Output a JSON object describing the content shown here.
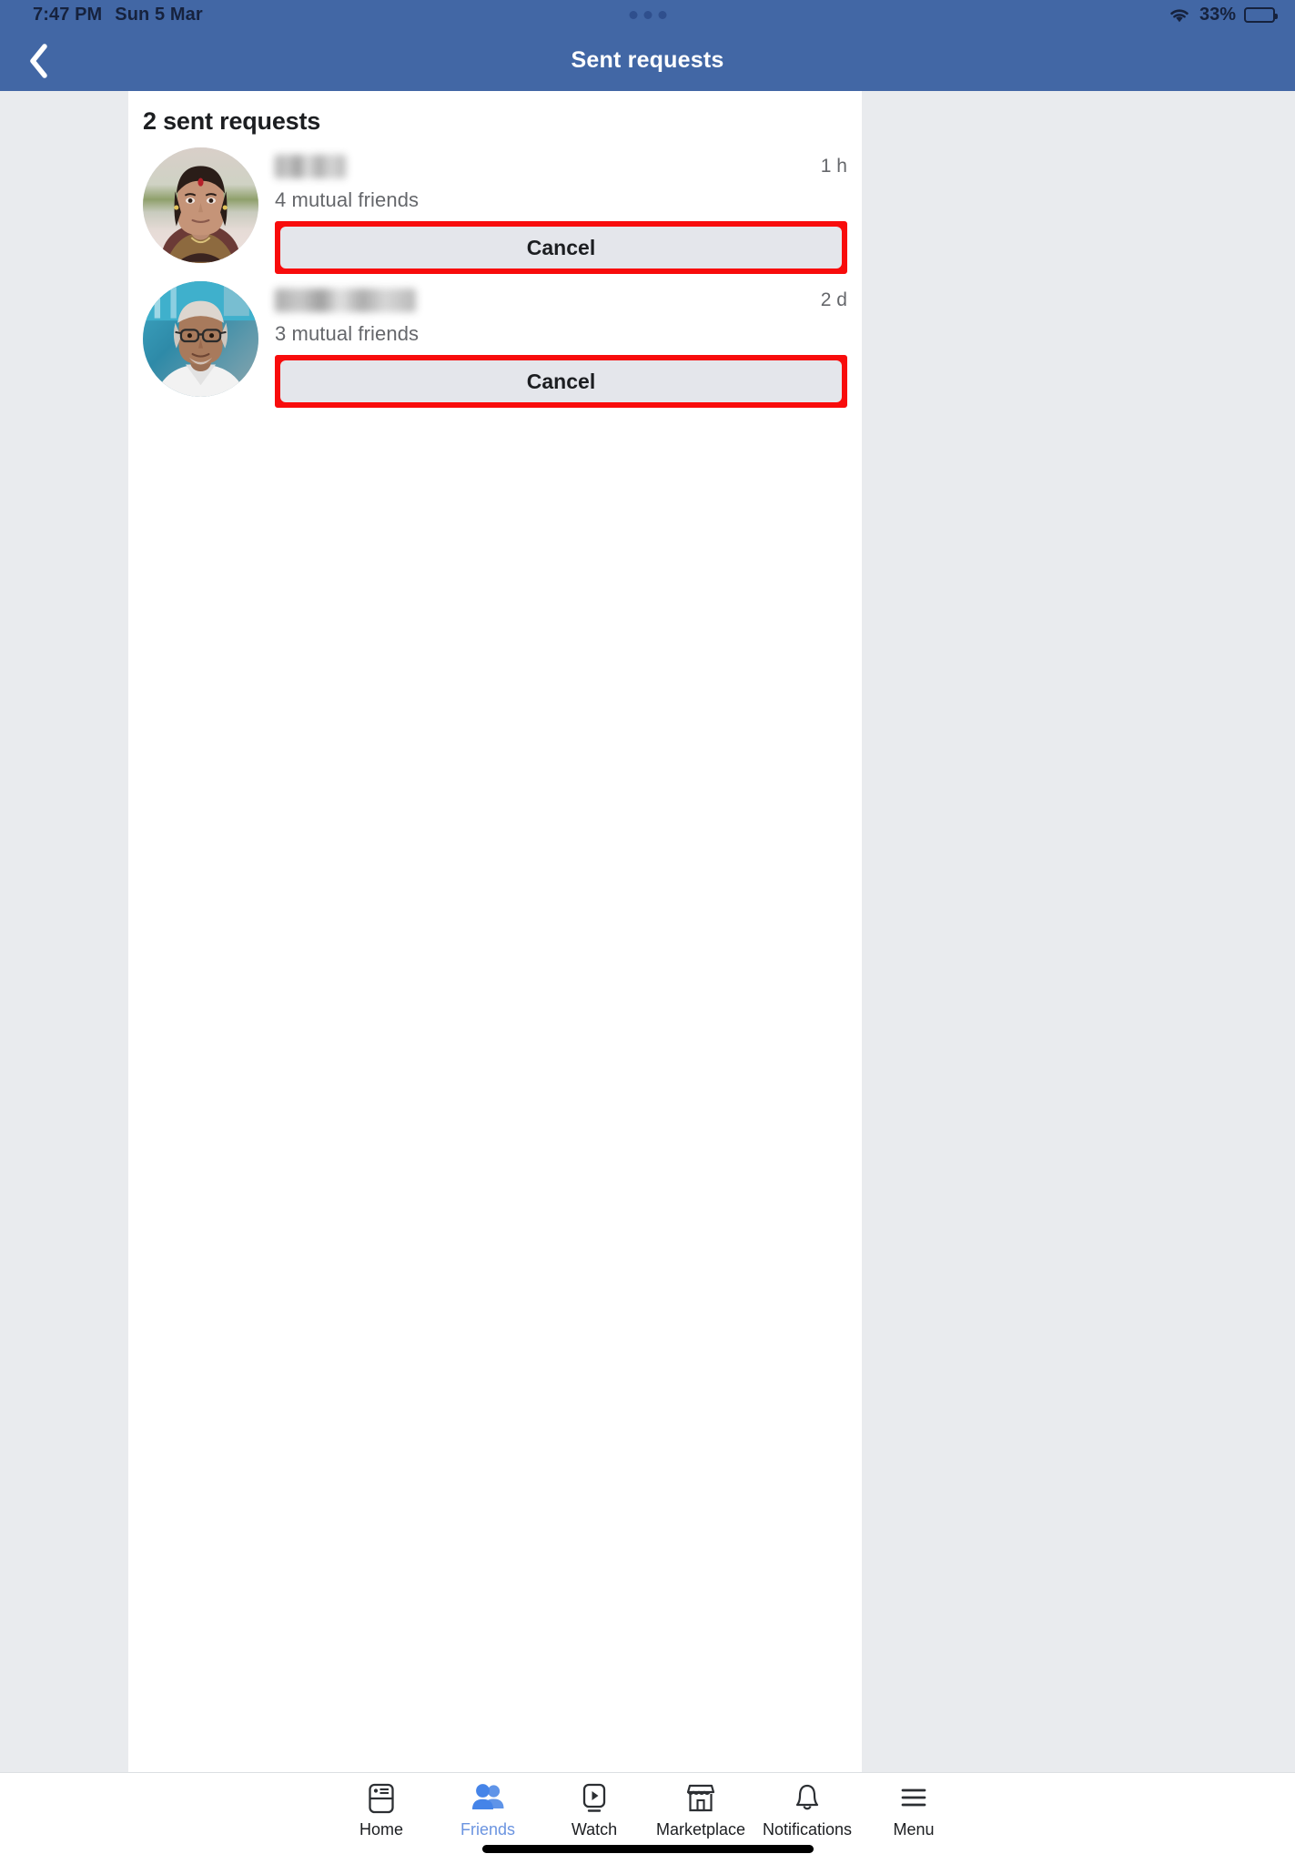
{
  "status_bar": {
    "time": "7:47 PM",
    "date": "Sun 5 Mar",
    "battery_percent": "33%",
    "battery_level": 33,
    "wifi_icon": "wifi-icon",
    "recording_dots_icon": "three-dots-icon"
  },
  "header": {
    "title": "Sent requests",
    "back_icon": "chevron-left-icon",
    "background_color": "#4267a5",
    "title_color": "#ffffff"
  },
  "main": {
    "page_title": "2 sent requests",
    "requests": [
      {
        "name": "",
        "name_redacted": true,
        "mutual_friends": "4 mutual friends",
        "timestamp": "1 h",
        "action_label": "Cancel",
        "highlighted": true,
        "avatar_name": "avatar-woman-sari"
      },
      {
        "name": "",
        "name_redacted": true,
        "mutual_friends": "3 mutual friends",
        "timestamp": "2 d",
        "action_label": "Cancel",
        "highlighted": true,
        "avatar_name": "avatar-elderly-man"
      }
    ]
  },
  "tab_bar": {
    "items": [
      {
        "label": "Home",
        "icon": "home-feed-icon",
        "active": false
      },
      {
        "label": "Friends",
        "icon": "friends-icon",
        "active": true
      },
      {
        "label": "Watch",
        "icon": "watch-play-icon",
        "active": false
      },
      {
        "label": "Marketplace",
        "icon": "marketplace-icon",
        "active": false
      },
      {
        "label": "Notifications",
        "icon": "bell-icon",
        "active": false
      },
      {
        "label": "Menu",
        "icon": "hamburger-menu-icon",
        "active": false
      }
    ]
  },
  "colors": {
    "header_blue": "#4267a5",
    "highlight_red": "#f80c0c",
    "button_grey": "#e4e6eb",
    "active_tab_blue": "#6b94e0",
    "page_background": "#e9ebee"
  }
}
